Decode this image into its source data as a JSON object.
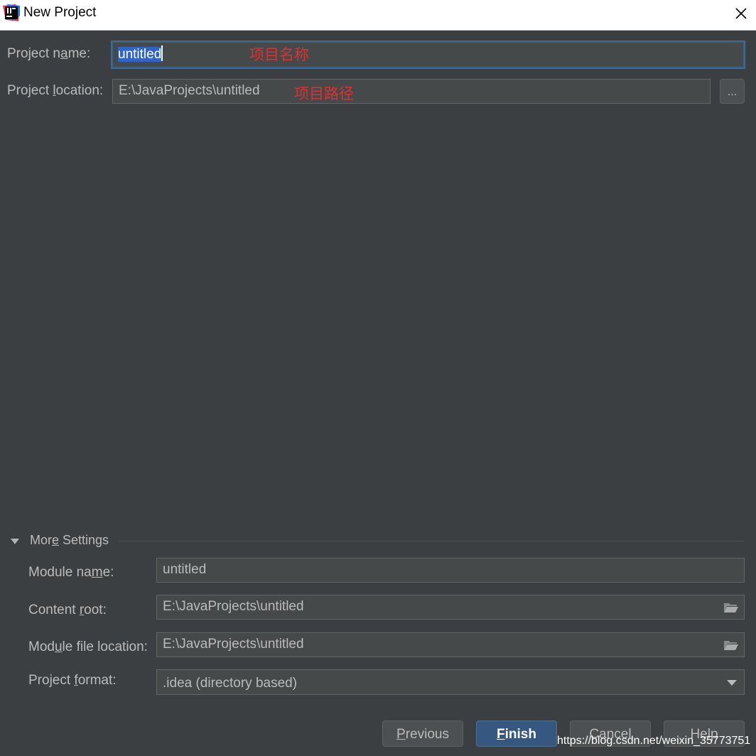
{
  "window": {
    "title": "New Project",
    "app_icon": "intellij-idea-icon",
    "close_icon": "close-icon"
  },
  "project": {
    "name_label_pre": "Project n",
    "name_label_u": "a",
    "name_label_post": "me:",
    "name_value": "untitled",
    "name_annotation": "项目名称",
    "location_label_pre": "Project ",
    "location_label_u": "l",
    "location_label_post": "ocation:",
    "location_value": "E:\\JavaProjects\\untitled",
    "location_annotation": "项目路径",
    "browse_label": "..."
  },
  "more_settings": {
    "header_pre": "Mor",
    "header_u": "e",
    "header_post": " Settings",
    "expanded": true,
    "module_name_label_pre": "Module na",
    "module_name_label_u": "m",
    "module_name_label_post": "e:",
    "module_name_value": "untitled",
    "content_root_label_pre": "Content ",
    "content_root_label_u": "r",
    "content_root_label_post": "oot:",
    "content_root_value": "E:\\JavaProjects\\untitled",
    "module_file_label_pre": "Mod",
    "module_file_label_u": "u",
    "module_file_label_post": "le file location:",
    "module_file_value": "E:\\JavaProjects\\untitled",
    "format_label_pre": "Project ",
    "format_label_u": "f",
    "format_label_post": "ormat:",
    "format_value": ".idea (directory based)"
  },
  "buttons": {
    "previous_u": "P",
    "previous_rest": "revious",
    "finish_u": "F",
    "finish_rest": "inish",
    "cancel": "Cancel",
    "help": "Help"
  },
  "watermark": "https://blog.csdn.net/weixin_35773751",
  "colors": {
    "background": "#3c3f41",
    "field": "#45494a",
    "focus_border": "#3d6185",
    "primary_button": "#365880",
    "annotation": "#e03030"
  }
}
